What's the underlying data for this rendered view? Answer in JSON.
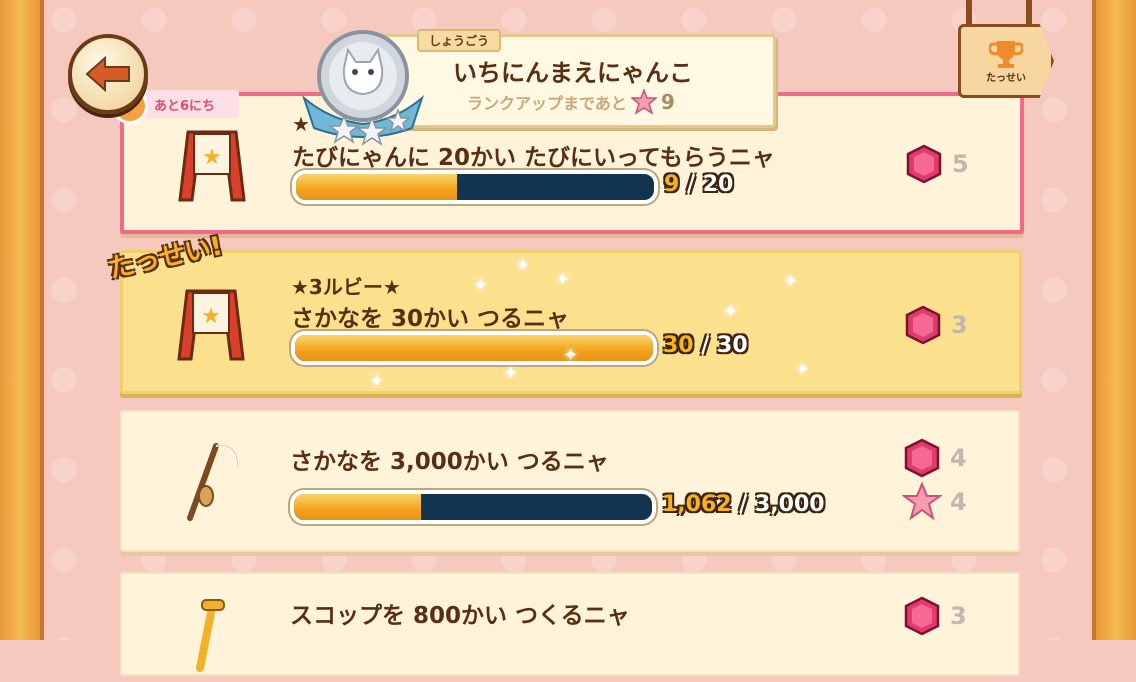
{
  "rank": {
    "tag": "しょうごう",
    "title": "いちにんまえにゃんこ",
    "to_next_label": "ランクアップまであと",
    "to_next_count": "9"
  },
  "achievements_button_label": "たっせい",
  "missions": [
    {
      "days_left": "あと6にち",
      "rank_label": "★",
      "text": "たびにゃんに 20かい たびにいってもらうニャ",
      "current": "9",
      "separator": "/",
      "target": "20",
      "progress": 0.45,
      "rewards": [
        {
          "icon": "ruby-icon",
          "amount": "5"
        }
      ],
      "state": "active"
    },
    {
      "done_label": "たっせい!",
      "rank_label": "★3ルビー★",
      "text": "さかなを 30かい つるニャ",
      "current": "30",
      "separator": "/",
      "target": "30",
      "progress": 1.0,
      "rewards": [
        {
          "icon": "ruby-icon",
          "amount": "3"
        }
      ],
      "state": "completed"
    },
    {
      "text": "さかなを 3,000かい つるニャ",
      "current": "1,062",
      "separator": "/",
      "target": "3,000",
      "progress": 0.354,
      "rewards": [
        {
          "icon": "ruby-icon",
          "amount": "4"
        },
        {
          "icon": "pink-star-icon",
          "amount": "4"
        }
      ],
      "state": "normal"
    },
    {
      "text": "スコップを 800かい つくるニャ",
      "rewards": [
        {
          "icon": "ruby-icon",
          "amount": "3"
        }
      ],
      "state": "normal"
    }
  ],
  "colors": {
    "background": "#f6c9bf",
    "accent_pink": "#ef6c87",
    "gold": "#f6b21f",
    "text_brown": "#5a2e12"
  }
}
